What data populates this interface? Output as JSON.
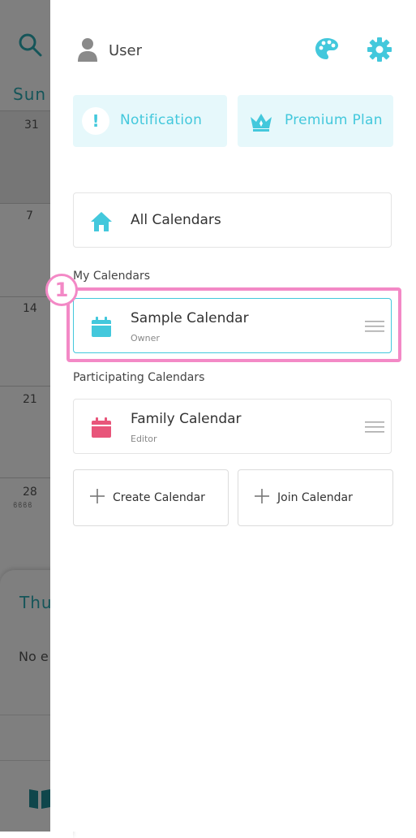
{
  "background": {
    "weekday_header": "Sun",
    "day_numbers": [
      "31",
      "7",
      "14",
      "21",
      "28"
    ],
    "event_dots": "ϐϐϐϐ",
    "detail_day": "Thu",
    "no_events_text": "No e"
  },
  "drawer": {
    "user_name": "User",
    "notification_label": "Notification",
    "notification_mark": "!",
    "premium_label": "Premium Plan",
    "all_calendars_label": "All Calendars",
    "my_calendars_header": "My Calendars",
    "my_calendars": [
      {
        "title": "Sample Calendar",
        "role": "Owner",
        "color": "#43c8dc"
      }
    ],
    "participating_header": "Participating Calendars",
    "participating_calendars": [
      {
        "title": "Family Calendar",
        "role": "Editor",
        "color": "#e8557a"
      }
    ],
    "create_calendar_label": "Create Calendar",
    "join_calendar_label": "Join Calendar"
  },
  "annotation": {
    "step_number": "1"
  },
  "colors": {
    "accent": "#43c8dc",
    "highlight": "#f389c6",
    "family": "#e8557a"
  }
}
